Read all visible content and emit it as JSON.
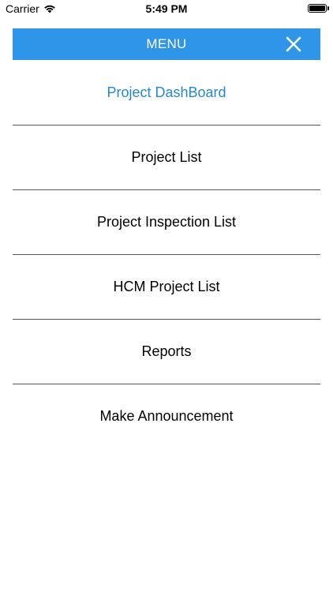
{
  "status_bar": {
    "carrier": "Carrier",
    "time": "5:49 PM",
    "wifi_icon": "wifi-icon",
    "battery_icon": "battery-icon",
    "battery_level": 1.0
  },
  "header": {
    "title": "MENU",
    "close_icon": "close-icon",
    "background_color": "#2f95e9"
  },
  "menu": {
    "active_color": "#2489cf",
    "items": [
      {
        "label": "Project DashBoard"
      },
      {
        "label": "Project List"
      },
      {
        "label": "Project Inspection List"
      },
      {
        "label": "HCM Project List"
      },
      {
        "label": "Reports"
      },
      {
        "label": "Make Announcement"
      }
    ]
  }
}
